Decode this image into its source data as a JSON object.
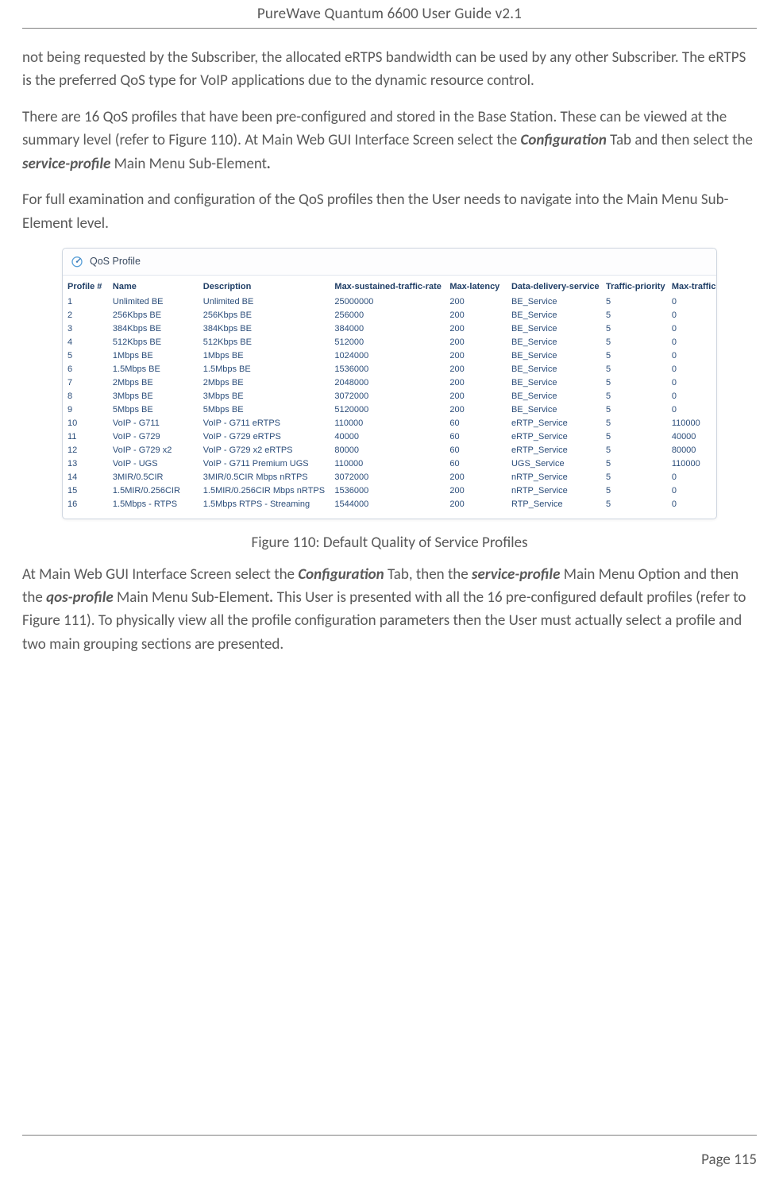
{
  "header": {
    "title": "PureWave Quantum 6600 User Guide v2.1"
  },
  "paragraphs": {
    "p1": "not being requested by the Subscriber, the allocated eRTPS bandwidth can be used by any other Subscriber. The eRTPS is the preferred QoS type for VoIP applications due to the dynamic resource control.",
    "p2_a": "There are 16 QoS profiles that have been pre-configured and stored in the Base Station. These can be viewed at the summary level (refer to Figure 110). At Main Web GUI Interface Screen select the ",
    "p2_conf": "Configuration",
    "p2_b": " Tab and then select the ",
    "p2_sp": "service-profile",
    "p2_c": " Main Menu Sub-Element",
    "p2_dot": ".",
    "p3": "For full examination and configuration of the QoS profiles then the User needs to navigate into the Main Menu Sub-Element level.",
    "p4_a": "At Main Web GUI Interface Screen select the ",
    "p4_conf": "Configuration",
    "p4_b": " Tab, then the ",
    "p4_sp": "service-profile",
    "p4_c": " Main Menu Option and then the ",
    "p4_qos": "qos-profile",
    "p4_d": " Main Menu Sub-Element",
    "p4_dot": ".",
    "p4_e": " This User is presented with all the 16 pre-configured default profiles (refer to Figure 111). To physically view all the profile configuration parameters then the User must actually select a profile and two main grouping sections are presented."
  },
  "panel": {
    "title": "QoS Profile",
    "columns": [
      "Profile #",
      "Name",
      "Description",
      "Max-sustained-traffic-rate",
      "Max-latency",
      "Data-delivery-service",
      "Traffic-priority",
      "Max-traffic"
    ],
    "rows": [
      [
        "1",
        "Unlimited BE",
        "Unlimited BE",
        "25000000",
        "200",
        "BE_Service",
        "5",
        "0"
      ],
      [
        "2",
        "256Kbps BE",
        "256Kbps BE",
        "256000",
        "200",
        "BE_Service",
        "5",
        "0"
      ],
      [
        "3",
        "384Kbps BE",
        "384Kbps BE",
        "384000",
        "200",
        "BE_Service",
        "5",
        "0"
      ],
      [
        "4",
        "512Kbps BE",
        "512Kbps BE",
        "512000",
        "200",
        "BE_Service",
        "5",
        "0"
      ],
      [
        "5",
        "1Mbps BE",
        "1Mbps BE",
        "1024000",
        "200",
        "BE_Service",
        "5",
        "0"
      ],
      [
        "6",
        "1.5Mbps BE",
        "1.5Mbps BE",
        "1536000",
        "200",
        "BE_Service",
        "5",
        "0"
      ],
      [
        "7",
        "2Mbps BE",
        "2Mbps BE",
        "2048000",
        "200",
        "BE_Service",
        "5",
        "0"
      ],
      [
        "8",
        "3Mbps BE",
        "3Mbps BE",
        "3072000",
        "200",
        "BE_Service",
        "5",
        "0"
      ],
      [
        "9",
        "5Mbps BE",
        "5Mbps BE",
        "5120000",
        "200",
        "BE_Service",
        "5",
        "0"
      ],
      [
        "10",
        "VoIP - G711",
        "VoIP - G711 eRTPS",
        "110000",
        "60",
        "eRTP_Service",
        "5",
        "110000"
      ],
      [
        "11",
        "VoIP - G729",
        "VoIP - G729 eRTPS",
        "40000",
        "60",
        "eRTP_Service",
        "5",
        "40000"
      ],
      [
        "12",
        "VoIP - G729 x2",
        "VoIP - G729 x2 eRTPS",
        "80000",
        "60",
        "eRTP_Service",
        "5",
        "80000"
      ],
      [
        "13",
        "VoIP - UGS",
        "VoIP - G711 Premium UGS",
        "110000",
        "60",
        "UGS_Service",
        "5",
        "110000"
      ],
      [
        "14",
        "3MIR/0.5CIR",
        "3MIR/0.5CIR Mbps nRTPS",
        "3072000",
        "200",
        "nRTP_Service",
        "5",
        "0"
      ],
      [
        "15",
        "1.5MIR/0.256CIR",
        "1.5MIR/0.256CIR Mbps nRTPS",
        "1536000",
        "200",
        "nRTP_Service",
        "5",
        "0"
      ],
      [
        "16",
        "1.5Mbps - RTPS",
        "1.5Mbps RTPS - Streaming",
        "1544000",
        "200",
        "RTP_Service",
        "5",
        "0"
      ]
    ]
  },
  "figure_caption": "Figure 110: Default Quality of Service Profiles",
  "footer": {
    "page": "Page 115"
  }
}
